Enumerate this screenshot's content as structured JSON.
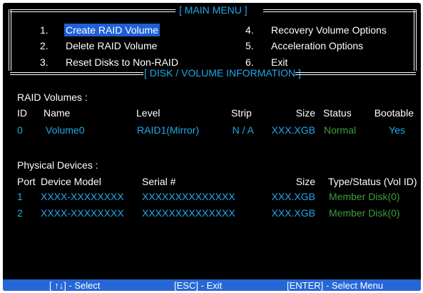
{
  "main_menu": {
    "title": "[ MAIN MENU ]",
    "items": [
      {
        "num": "1.",
        "label": "Create RAID Volume",
        "selected": true
      },
      {
        "num": "2.",
        "label": "Delete RAID Volume"
      },
      {
        "num": "3.",
        "label": "Reset Disks to Non-RAID"
      },
      {
        "num": "4.",
        "label": "Recovery Volume Options"
      },
      {
        "num": "5.",
        "label": "Acceleration Options"
      },
      {
        "num": "6.",
        "label": "Exit"
      }
    ]
  },
  "info": {
    "title": "[ DISK / VOLUME INFORMATION ]",
    "raid_volumes_label": "RAID Volumes :",
    "volume_headers": {
      "id": "ID",
      "name": "Name",
      "level": "Level",
      "strip": "Strip",
      "size": "Size",
      "status": "Status",
      "bootable": "Bootable"
    },
    "volumes": [
      {
        "id": "0",
        "name": "Volume0",
        "level": "RAID1(Mirror)",
        "strip": "N / A",
        "size": "XXX.XGB",
        "status": "Normal",
        "bootable": "Yes"
      }
    ],
    "physical_label": "Physical Devices :",
    "device_headers": {
      "port": "Port",
      "model": "Device Model",
      "serial": "Serial #",
      "size": "Size",
      "type": "Type/Status (Vol ID)"
    },
    "devices": [
      {
        "port": "1",
        "model": "XXXX-XXXXXXXX",
        "serial": "XXXXXXXXXXXXXX",
        "size": "XXX.XGB",
        "type": "Member Disk(0)"
      },
      {
        "port": "2",
        "model": "XXXX-XXXXXXXX",
        "serial": "XXXXXXXXXXXXXX",
        "size": "XXX.XGB",
        "type": "Member Disk(0)"
      }
    ]
  },
  "footer": {
    "select": "[ ↑↓] - Select",
    "exit": "[ESC] - Exit",
    "enter": "[ENTER] - Select Menu"
  },
  "colors": {
    "background": "#000000",
    "highlight": "#1e5fd6",
    "cyan_value": "#22a8e8",
    "green_status": "#3f9b3f",
    "footer_bar": "#2567d6"
  }
}
